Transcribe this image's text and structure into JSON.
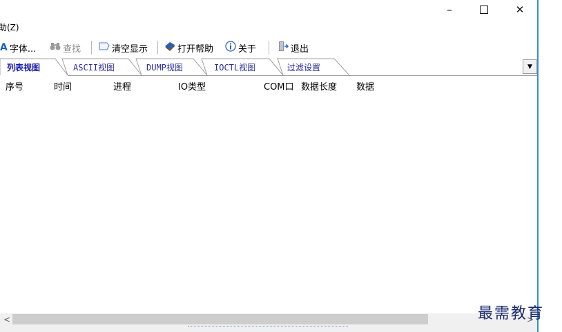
{
  "window": {
    "minimize_glyph": "–",
    "close_glyph": "✕"
  },
  "menubar": {
    "items": [
      {
        "label": "助(Z)"
      }
    ]
  },
  "toolbar": {
    "font": {
      "label": "字体...",
      "icon": "font-A-icon"
    },
    "find": {
      "label": "查找",
      "icon": "binoculars-icon",
      "disabled": true
    },
    "clear": {
      "label": "清空显示",
      "icon": "eraser-icon"
    },
    "help": {
      "label": "打开帮助",
      "icon": "book-icon"
    },
    "about": {
      "label": "关于",
      "icon": "info-icon"
    },
    "exit": {
      "label": "退出",
      "icon": "exit-door-icon"
    }
  },
  "tabs": [
    {
      "label": "列表视图",
      "active": true
    },
    {
      "label": "ASCII视图",
      "active": false
    },
    {
      "label": "DUMP视图",
      "active": false
    },
    {
      "label": "IOCTL视图",
      "active": false
    },
    {
      "label": "过滤设置",
      "active": false
    }
  ],
  "list": {
    "columns": [
      "序号",
      "时间",
      "进程",
      "IO类型",
      "COM口",
      "数据长度",
      "数据"
    ],
    "rows": []
  },
  "scrollbar": {
    "left_glyph": "<",
    "right_glyph": ">"
  },
  "watermark": "最需教育",
  "colors": {
    "accent_frame": "#2d8ee0",
    "tab_text": "#2a2a9a",
    "active_tab_text": "#1a1ab0"
  }
}
